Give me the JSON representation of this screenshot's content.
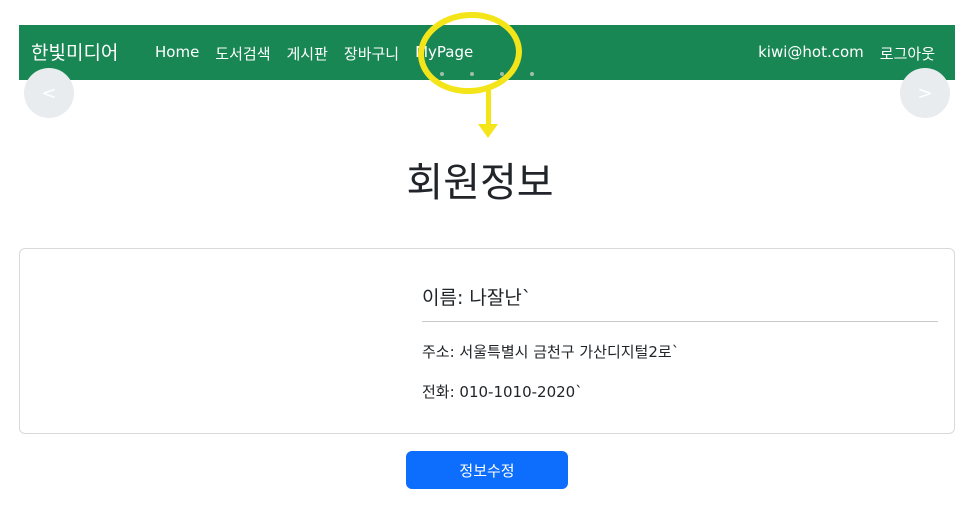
{
  "navbar": {
    "brand": "한빛미디어",
    "links": [
      "Home",
      "도서검색",
      "게시판",
      "장바구니",
      "MyPage"
    ],
    "user_email": "kiwi@hot.com",
    "logout": "로그아웃"
  },
  "carousel": {
    "prev_label": "<",
    "next_label": ">"
  },
  "page": {
    "title": "회원정보"
  },
  "member": {
    "name": "이름: 나잘난`",
    "address": "주소: 서울특별시 금천구 가산디지털2로`",
    "phone": "전화: 010-1010-2020`"
  },
  "actions": {
    "edit_label": "정보수정"
  },
  "colors": {
    "navbar_bg": "#198754",
    "primary_button": "#0d6efd",
    "annotation": "#f4e51a"
  }
}
